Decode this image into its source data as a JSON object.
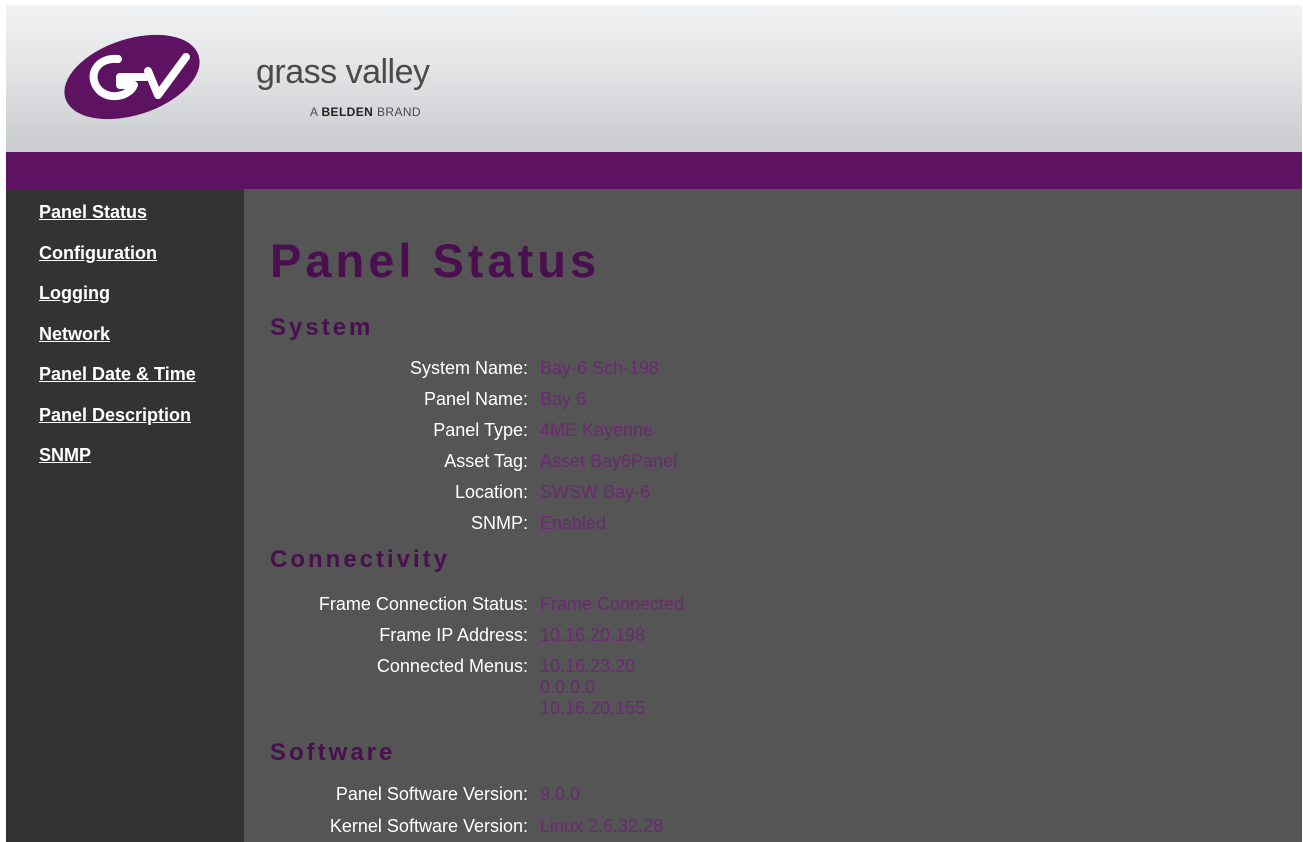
{
  "brand": {
    "name": "grass valley",
    "tagline_prefix": "A",
    "tagline_brand": "BELDEN",
    "tagline_suffix": "BRAND",
    "colors": {
      "purple": "#5e1362",
      "accent_text": "#4a0f4f",
      "value_text": "#6b2a72"
    }
  },
  "sidebar": {
    "items": [
      {
        "label": "Panel Status"
      },
      {
        "label": "Configuration"
      },
      {
        "label": "Logging"
      },
      {
        "label": "Network"
      },
      {
        "label": "Panel Date & Time"
      },
      {
        "label": "Panel Description"
      },
      {
        "label": "SNMP"
      }
    ]
  },
  "main": {
    "title": "Panel Status",
    "system": {
      "heading": "System",
      "rows": [
        {
          "label": "System Name:",
          "value": "Bay-6 Sch-198"
        },
        {
          "label": "Panel Name:",
          "value": "Bay 6"
        },
        {
          "label": "Panel Type:",
          "value": "4ME Kayenne"
        },
        {
          "label": "Asset Tag:",
          "value": "Asset Bay6Panel"
        },
        {
          "label": "Location:",
          "value": "SWSW Bay-6"
        },
        {
          "label": "SNMP:",
          "value": "Enabled"
        }
      ]
    },
    "connectivity": {
      "heading": "Connectivity",
      "frame_status_label": "Frame Connection Status:",
      "frame_status_value": "Frame Connected",
      "frame_ip_label": "Frame IP Address:",
      "frame_ip_value": "10.16.20.198",
      "menus_label": "Connected Menus:",
      "menus": [
        "10.16.23.20",
        "0.0.0.0",
        "10.16.20.155"
      ]
    },
    "software": {
      "heading": "Software",
      "rows": [
        {
          "label": "Panel Software Version:",
          "value": "9.0.0"
        },
        {
          "label": "Kernel Software Version:",
          "value": "Linux 2.6.32.28"
        }
      ]
    }
  }
}
